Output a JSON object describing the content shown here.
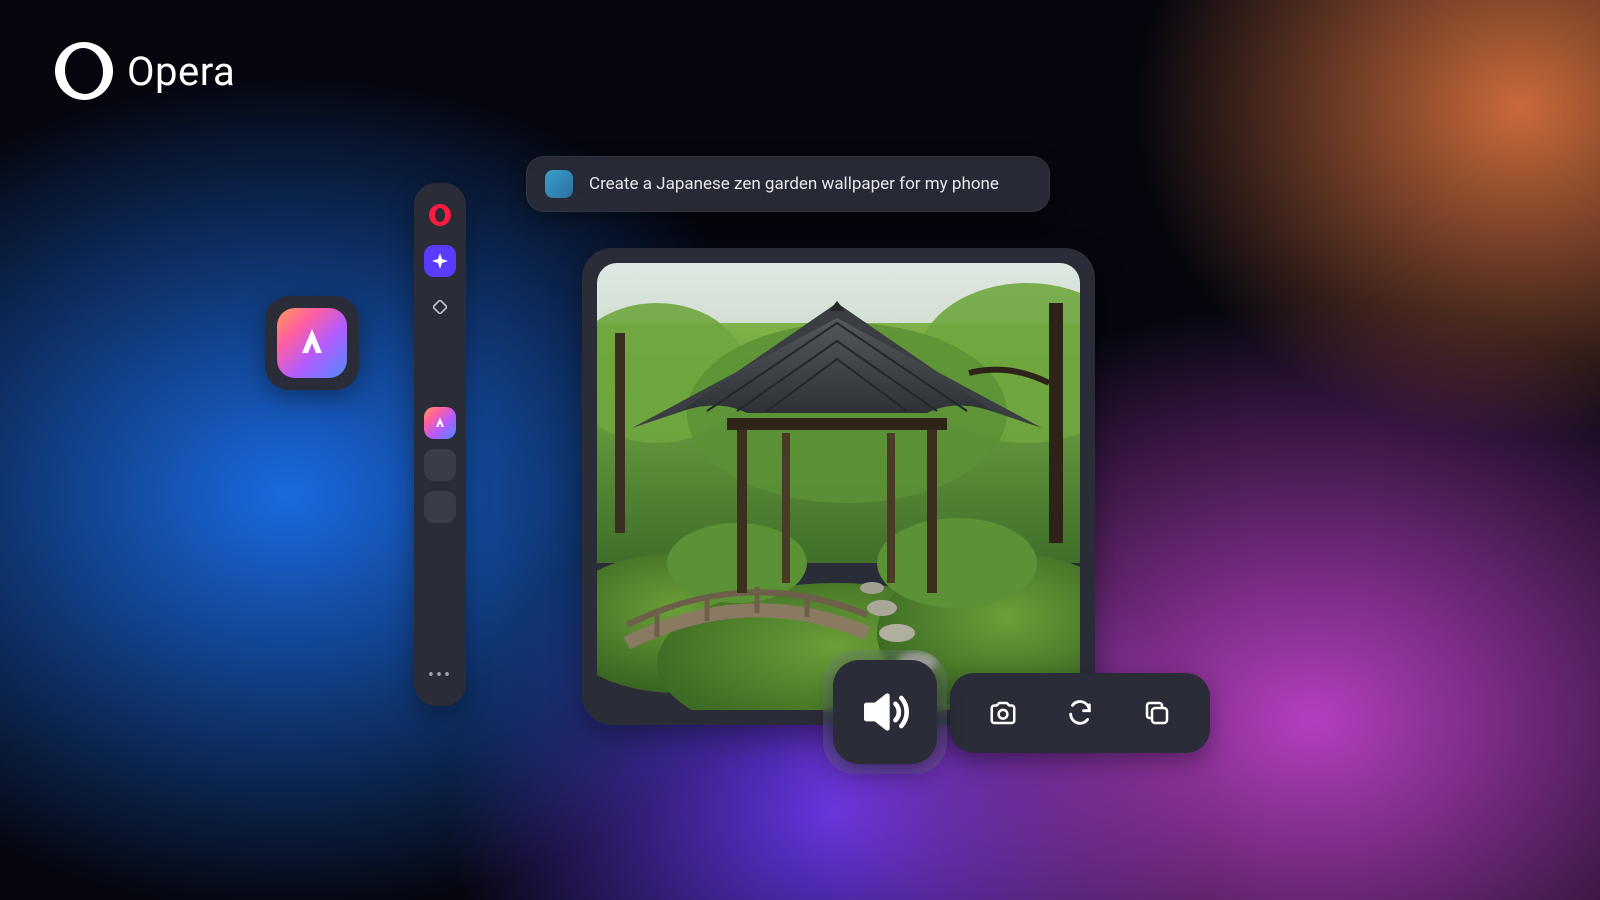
{
  "brand": {
    "name": "Opera"
  },
  "sidebar": {
    "items": [
      {
        "id": "opera",
        "icon": "opera-logo-icon"
      },
      {
        "id": "ai",
        "icon": "sparkle-icon"
      },
      {
        "id": "new",
        "icon": "diamond-outline-icon"
      }
    ],
    "thumbs": [
      {
        "id": "aria-app",
        "icon": "aria-icon"
      },
      {
        "id": "slot-1"
      },
      {
        "id": "slot-2"
      }
    ],
    "more": "•••"
  },
  "aria_tile": {
    "icon": "aria-icon"
  },
  "prompt": {
    "avatar": "garden-thumb",
    "text": "Create a Japanese zen garden  wallpaper for my phone"
  },
  "result_image": {
    "alt": "Japanese zen garden with wooden pavilion, arched footbridge, moss and stepping-stone path"
  },
  "actions": {
    "speak": "speaker-icon",
    "snapshot": "camera-icon",
    "regenerate": "refresh-icon",
    "copy": "copy-icon"
  }
}
